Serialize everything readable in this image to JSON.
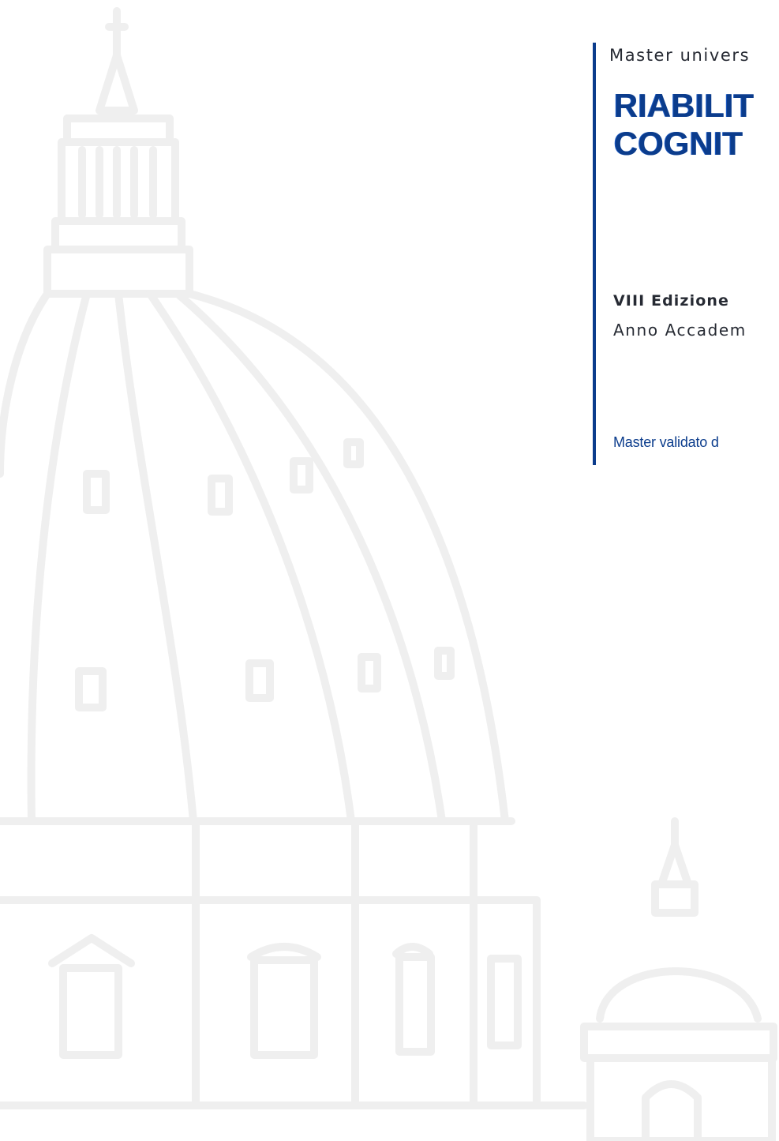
{
  "header": {
    "kicker": "Master univers"
  },
  "title": {
    "line1": "RIABILIT",
    "line2": "COGNIT"
  },
  "edition": {
    "label": "VIII Edizione",
    "academic_year": "Anno Accadem"
  },
  "footer_note": "Master validato d",
  "colors": {
    "brand_blue": "#0b3c8c",
    "text_dark": "#262a33",
    "watermark_gray": "#eeeeee"
  },
  "watermark": {
    "subject": "cupola-dome-icon"
  }
}
